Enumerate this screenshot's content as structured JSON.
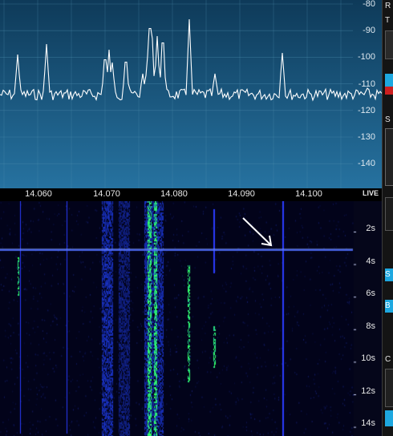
{
  "spectrum": {
    "db_scale": [
      "-80",
      "-90",
      "-100",
      "-110",
      "-120",
      "-130",
      "-140"
    ],
    "colors": {
      "background_top": "#0f3f60",
      "background_bottom": "#236d92",
      "trace": "#ffffff",
      "grid": "#4f8fb0"
    }
  },
  "frequency_axis": {
    "labels": [
      "14.060",
      "14.070",
      "14.080",
      "14.090",
      "14.100"
    ],
    "live_label": "LIVE"
  },
  "waterfall": {
    "time_labels": [
      "2s",
      "4s",
      "6s",
      "8s",
      "10s",
      "12s",
      "14s"
    ],
    "arrow_annotation": "white-arrow",
    "colors": {
      "background": "#02031a",
      "signal_weak": "#1a2cb8",
      "signal_strong": "#33ff66"
    }
  },
  "sidebar": {
    "items": [
      "R",
      "T",
      "S",
      "S",
      "B",
      "C"
    ],
    "badge_color": "#cc1f1f",
    "button_color": "#1ea8e0"
  }
}
